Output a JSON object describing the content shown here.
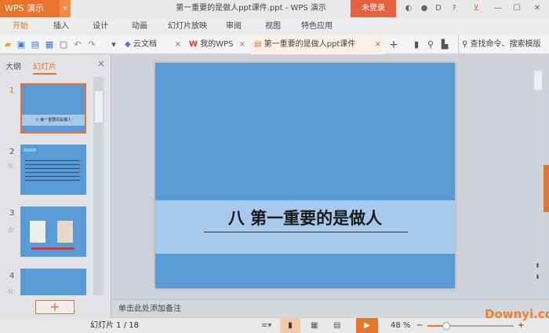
{
  "app": {
    "logo": "WPS 演示",
    "title": "第一重要的是做人ppt课件.ppt - WPS 演示",
    "login": "未登录"
  },
  "menu": [
    "开始",
    "插入",
    "设计",
    "动画",
    "幻灯片放映",
    "审阅",
    "视图",
    "特色应用"
  ],
  "tabs": [
    {
      "label": "云文档"
    },
    {
      "label": "我的WPS"
    },
    {
      "label": "第一重要的是做人ppt课件"
    }
  ],
  "search": {
    "placeholder": "查找命令、搜索模版"
  },
  "panel": {
    "tab_outline": "大纲",
    "tab_slides": "幻灯片",
    "slides": [
      {
        "num": "1",
        "title": "八 第一重要的是做人"
      },
      {
        "num": "2"
      },
      {
        "num": "3"
      },
      {
        "num": "4"
      }
    ]
  },
  "slide": {
    "title": "八  第一重要的是做人"
  },
  "notes": {
    "placeholder": "单击此处添加备注"
  },
  "status": {
    "slide_counter": "幻灯片 1 / 18",
    "zoom": "48 %",
    "zoom_level": 48,
    "watermark": "Downyi.com"
  },
  "colors": {
    "accent": "#e8732b",
    "slide_bg": "#5b9bd5",
    "band": "#a7c9ec"
  }
}
